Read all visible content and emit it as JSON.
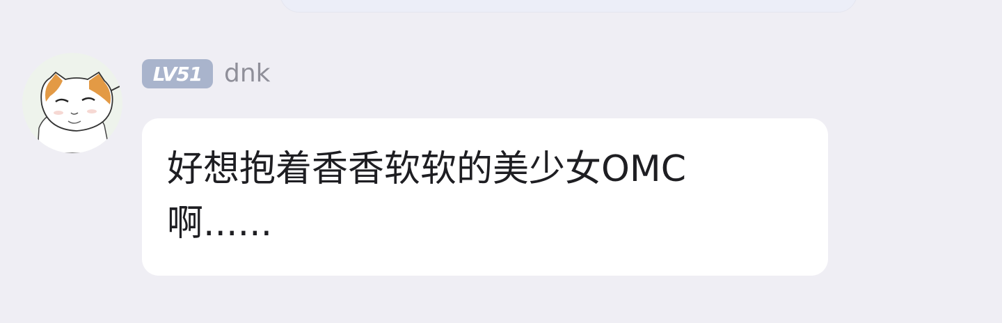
{
  "comment": {
    "level_badge": "LV51",
    "username": "dnk",
    "message": "好想抱着香香软软的美少女OMC啊......"
  },
  "colors": {
    "background": "#efeef4",
    "bubble": "#ffffff",
    "level_badge": "#a9b4cc",
    "username": "#8f8f99",
    "message_text": "#1e1e22"
  },
  "icons": {
    "avatar": "cat-meme-avatar"
  }
}
